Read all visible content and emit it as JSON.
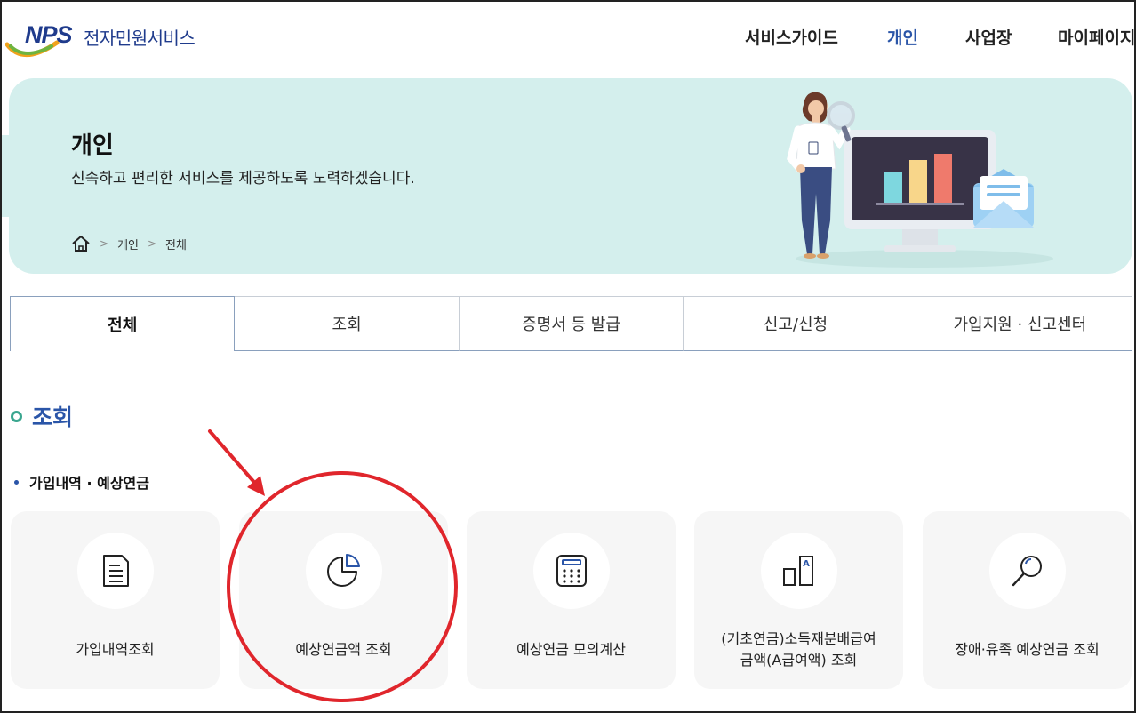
{
  "header": {
    "logo_mark": "NPS",
    "logo_text": "전자민원서비스",
    "nav": [
      {
        "label": "서비스가이드",
        "active": false
      },
      {
        "label": "개인",
        "active": true
      },
      {
        "label": "사업장",
        "active": false
      },
      {
        "label": "마이페이지",
        "active": false
      }
    ]
  },
  "banner": {
    "title": "개인",
    "description": "신속하고 편리한 서비스를 제공하도록 노력하겠습니다.",
    "breadcrumb": [
      "개인",
      "전체"
    ],
    "home_icon": "home-icon"
  },
  "tabs": [
    {
      "label": "전체",
      "active": true
    },
    {
      "label": "조회",
      "active": false
    },
    {
      "label": "증명서 등 발급",
      "active": false
    },
    {
      "label": "신고/신청",
      "active": false
    },
    {
      "label": "가입지원 · 신고센터",
      "active": false
    }
  ],
  "section": {
    "title": "조회",
    "subsection": "가입내역 · 예상연금",
    "cards": [
      {
        "label": "가입내역조회",
        "icon": "document-icon"
      },
      {
        "label": "예상연금액 조회",
        "icon": "pie-chart-icon"
      },
      {
        "label": "예상연금 모의계산",
        "icon": "calculator-icon"
      },
      {
        "label": "(기초연금)소득재분배급여\n금액(A급여액) 조회",
        "icon": "building-a-icon"
      },
      {
        "label": "장애·유족 예상연금 조회",
        "icon": "magnifier-icon"
      }
    ]
  },
  "colors": {
    "brand_blue": "#2a55a8",
    "banner_bg": "#d4efed",
    "section_dot": "#3aa68f",
    "annotation_red": "#e0262c"
  }
}
